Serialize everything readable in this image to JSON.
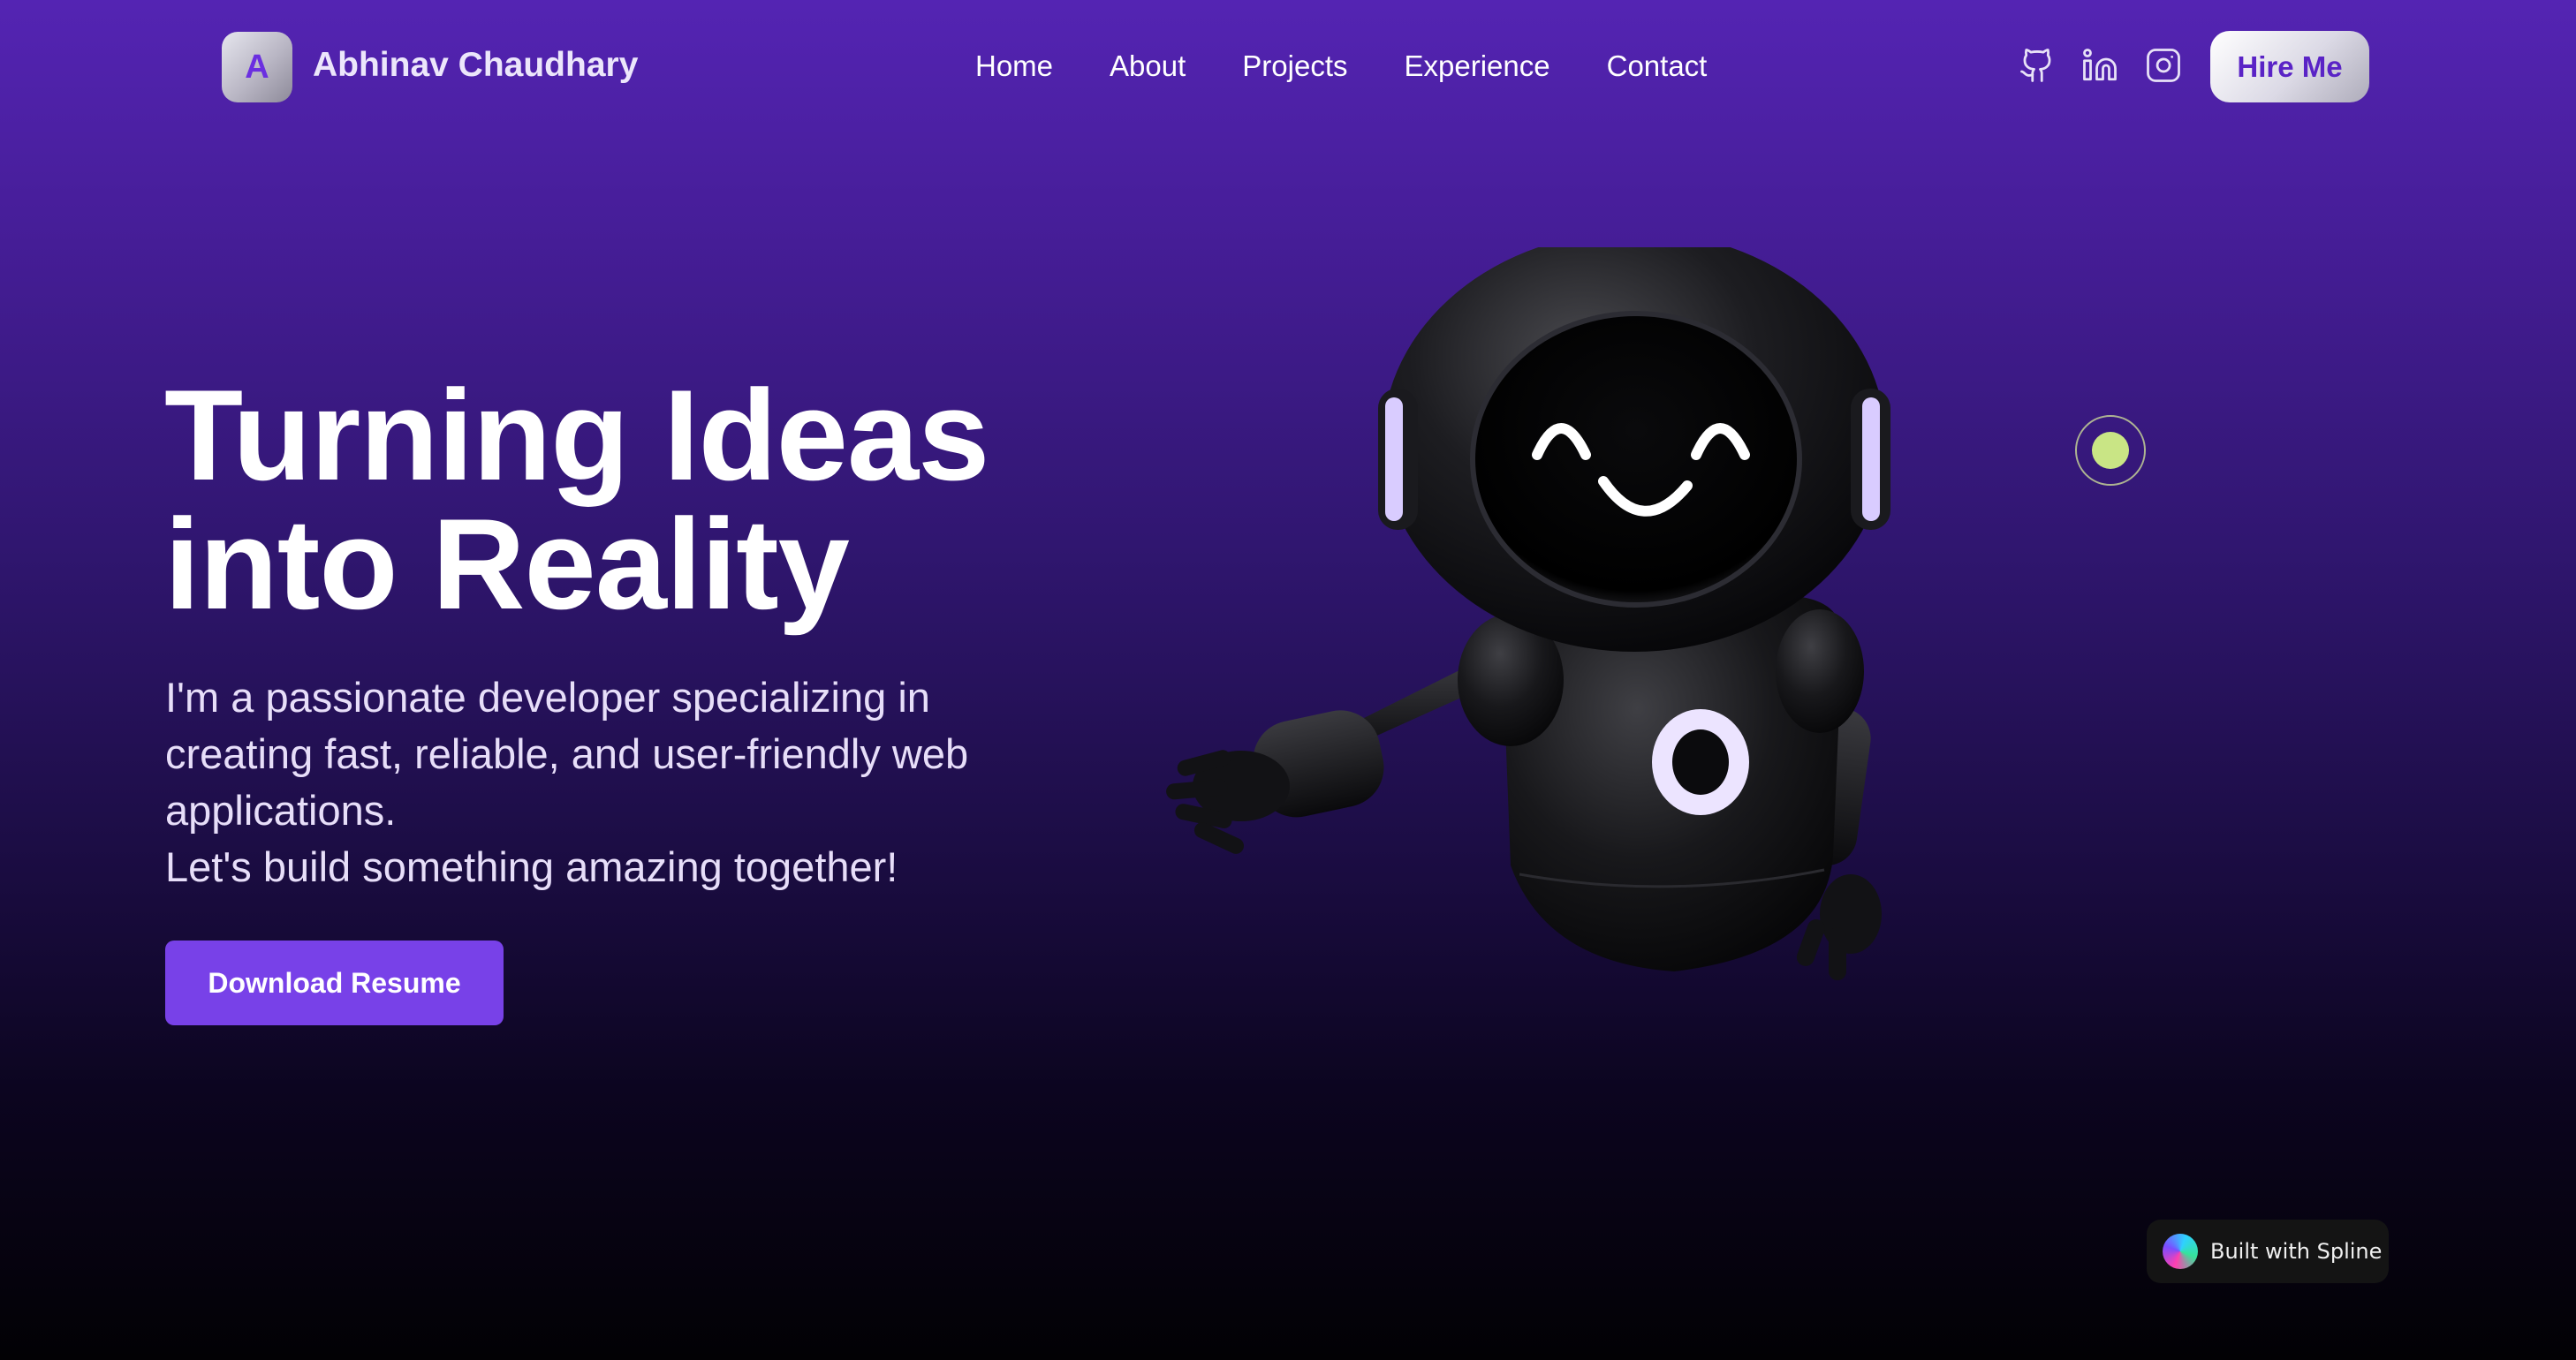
{
  "header": {
    "logo_letter": "A",
    "brand_name": "Abhinav Chaudhary",
    "nav": [
      {
        "label": "Home"
      },
      {
        "label": "About"
      },
      {
        "label": "Projects"
      },
      {
        "label": "Experience"
      },
      {
        "label": "Contact"
      }
    ],
    "social_icons": [
      "github-icon",
      "linkedin-icon",
      "instagram-icon"
    ],
    "hire_label": "Hire Me"
  },
  "hero": {
    "title_line1": "Turning Ideas",
    "title_line2": "into Reality",
    "desc_line1": "I'm a passionate developer specializing in",
    "desc_line2": "creating fast, reliable, and user-friendly web",
    "desc_line3": "applications.",
    "desc_line4": "Let's build something amazing together!",
    "download_label": "Download Resume"
  },
  "badge": {
    "text": "Built with Spline"
  },
  "colors": {
    "accent": "#7841e8",
    "hire_text": "#5a23c6",
    "target_dot": "#c9e585",
    "bg_top": "#5424b3",
    "bg_bottom": "#020104"
  }
}
